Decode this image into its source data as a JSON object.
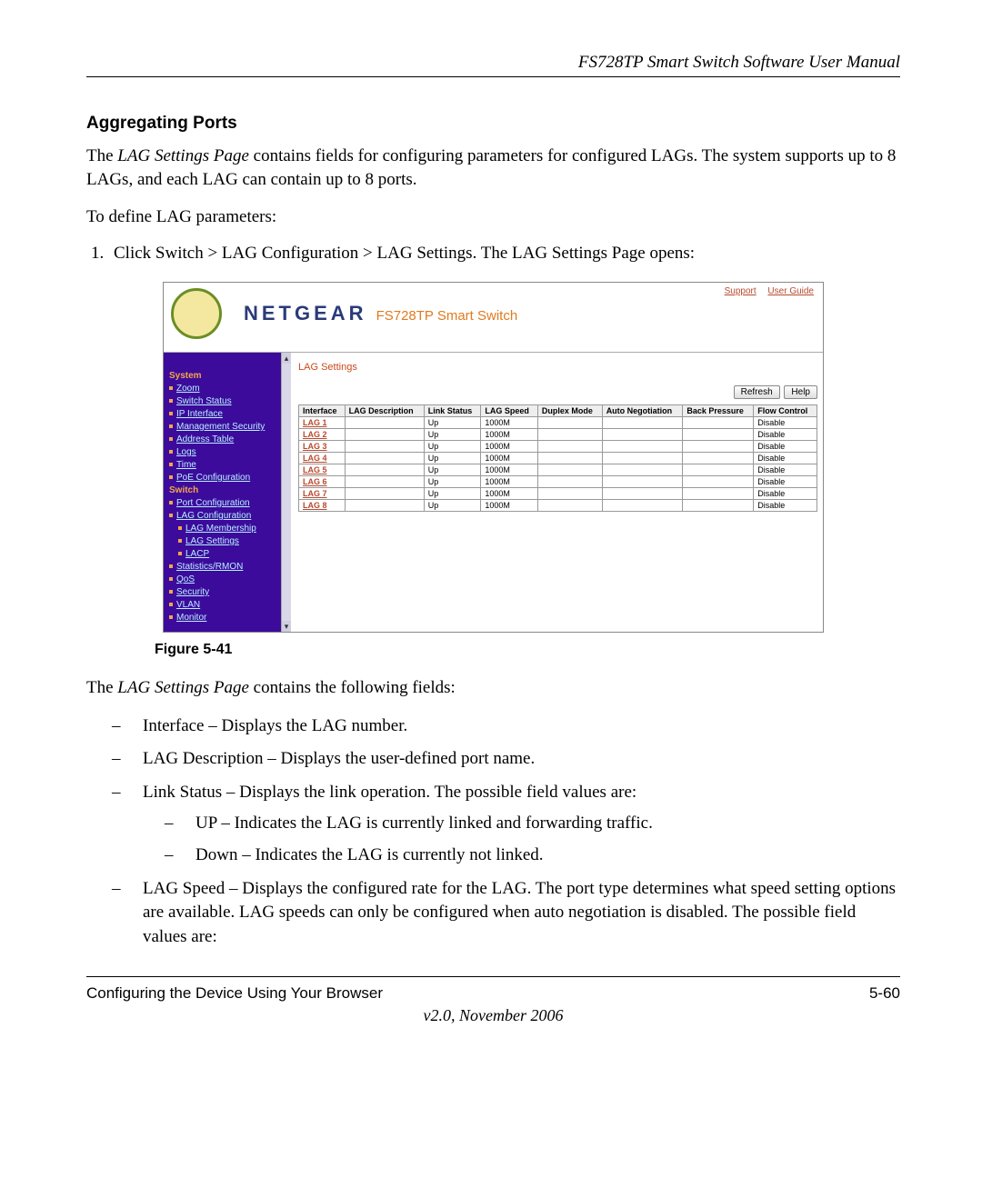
{
  "doc": {
    "header": "FS728TP Smart Switch Software User Manual",
    "section_heading": "Aggregating Ports",
    "intro_prefix": "The ",
    "intro_page_name": "LAG Settings Page",
    "intro_rest": " contains fields for configuring parameters for configured LAGs. The system supports up to 8 LAGs, and each LAG can contain up to 8 ports.",
    "to_define": "To define LAG parameters:",
    "step1_prefix": "Click ",
    "step1_bold": "Switch > LAG Configuration > LAG Settings",
    "step1_mid": ". The ",
    "step1_ital": "LAG Settings Page",
    "step1_end": " opens:",
    "figure_caption": "Figure 5-41",
    "contains_prefix": "The ",
    "contains_ital": "LAG Settings Page",
    "contains_rest": " contains the following fields:",
    "fields": {
      "interface_label": "Interface",
      "interface_desc": " – Displays the LAG number.",
      "lagdesc_label": "LAG Description",
      "lagdesc_desc": " – Displays the user-defined port name.",
      "linkstatus_label": "Link Status",
      "linkstatus_desc": " – Displays the link operation. The possible field values are:",
      "up_label": "UP",
      "up_desc": " – Indicates the LAG is currently linked and forwarding traffic.",
      "down_label": "Down",
      "down_desc": " – Indicates the LAG is currently not linked.",
      "lagspeed_label": "LAG Speed",
      "lagspeed_desc": " – Displays the configured rate for the LAG. The port type determines what speed setting options are available. LAG speeds can only be configured when auto negotiation is disabled. The possible field values are:"
    },
    "footer": {
      "left": "Configuring the Device Using Your Browser",
      "right": "5-60",
      "version": "v2.0, November 2006"
    }
  },
  "screenshot": {
    "brand": "NETGEAR",
    "product": "FS728TP Smart Switch",
    "top_links": {
      "support": "Support",
      "guide": "User Guide"
    },
    "panel_title": "LAG Settings",
    "buttons": {
      "refresh": "Refresh",
      "help": "Help"
    },
    "sidebar": {
      "section_system": "System",
      "zoom": "Zoom",
      "switch_status": "Switch Status",
      "ip_interface": "IP Interface",
      "mgmt_security": "Management Security",
      "address_table": "Address Table",
      "logs": "Logs",
      "time": "Time",
      "poe_config": "PoE Configuration",
      "section_switch": "Switch",
      "port_config": "Port Configuration",
      "lag_config": "LAG Configuration",
      "lag_membership": "LAG Membership",
      "lag_settings": "LAG Settings",
      "lacp": "LACP",
      "stats_rmon": "Statistics/RMON",
      "qos": "QoS",
      "security": "Security",
      "vlan": "VLAN",
      "monitor": "Monitor"
    },
    "columns": {
      "interface": "Interface",
      "lag_desc": "LAG Description",
      "link_status": "Link Status",
      "lag_speed": "LAG Speed",
      "duplex": "Duplex Mode",
      "auto_neg": "Auto Negotiation",
      "back_pressure": "Back Pressure",
      "flow_control": "Flow Control"
    },
    "rows": [
      {
        "iface": "LAG 1",
        "ls": "Up",
        "sp": "1000M",
        "fc": "Disable"
      },
      {
        "iface": "LAG 2",
        "ls": "Up",
        "sp": "1000M",
        "fc": "Disable"
      },
      {
        "iface": "LAG 3",
        "ls": "Up",
        "sp": "1000M",
        "fc": "Disable"
      },
      {
        "iface": "LAG 4",
        "ls": "Up",
        "sp": "1000M",
        "fc": "Disable"
      },
      {
        "iface": "LAG 5",
        "ls": "Up",
        "sp": "1000M",
        "fc": "Disable"
      },
      {
        "iface": "LAG 6",
        "ls": "Up",
        "sp": "1000M",
        "fc": "Disable"
      },
      {
        "iface": "LAG 7",
        "ls": "Up",
        "sp": "1000M",
        "fc": "Disable"
      },
      {
        "iface": "LAG 8",
        "ls": "Up",
        "sp": "1000M",
        "fc": "Disable"
      }
    ]
  }
}
